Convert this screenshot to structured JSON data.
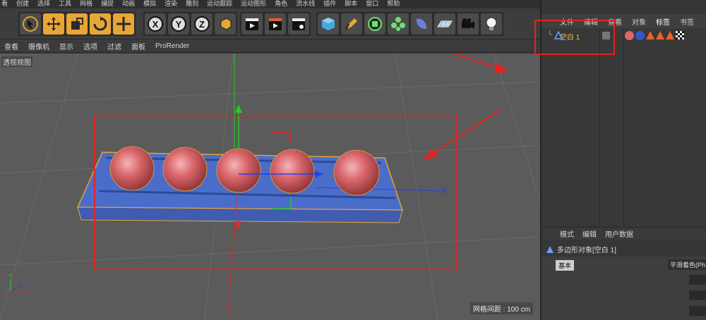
{
  "menubar": {
    "items": [
      "看",
      "创建",
      "选择",
      "工具",
      "网格",
      "捕捉",
      "动画",
      "模拟",
      "渲染",
      "雕刻",
      "运动跟踪",
      "运动图形",
      "角色",
      "流水线",
      "插件",
      "脚本",
      "窗口",
      "帮助"
    ]
  },
  "toolbar": {
    "groups": [
      [
        "arrow-select-icon",
        "move-icon",
        "scale-icon",
        "rotate-icon",
        "move-axis-icon"
      ],
      [
        "x-axis-icon",
        "y-axis-icon",
        "z-axis-icon",
        "coord-system-icon"
      ],
      [
        "render-view-icon",
        "render-picture-icon",
        "render-settings-icon"
      ],
      [
        "cube-icon",
        "pen-icon",
        "subdivide-icon",
        "cloner-icon",
        "deformer-icon",
        "floor-icon",
        "camera-icon",
        "light-icon"
      ]
    ]
  },
  "viewport_menu": {
    "items": [
      "查看",
      "摄像机",
      "显示",
      "选项",
      "过滤",
      "面板",
      "ProRender"
    ],
    "icons": [
      "move-view-icon",
      "zoom-view-icon",
      "rotate-view-icon",
      "maximize-view-icon"
    ]
  },
  "viewport": {
    "label": "透视视图",
    "grid_spacing": "网格间距 : 100 cm",
    "spheres": 5,
    "colors": {
      "background": "#5b5b5b",
      "sphere": "#d9666b",
      "box": "#4b6fd0",
      "selection": "#e8a634",
      "x_axis": "#2a40e0",
      "y_axis": "#28c828",
      "z_axis": "#e02a2a"
    }
  },
  "object_manager": {
    "tabs": [
      "文件",
      "编辑",
      "查看",
      "对象",
      "标签",
      "书签"
    ],
    "active_tab": "标签",
    "objects": [
      {
        "name": "空白 1",
        "icon": "null-object-icon"
      }
    ]
  },
  "attribute_manager": {
    "tabs": [
      "模式",
      "编辑",
      "用户数据"
    ],
    "title": "多边形对象[空白 1]",
    "basic_tab": "基本",
    "smooth_label": "平滑着色(Ph"
  },
  "annotations": {
    "color": "#e12424"
  }
}
